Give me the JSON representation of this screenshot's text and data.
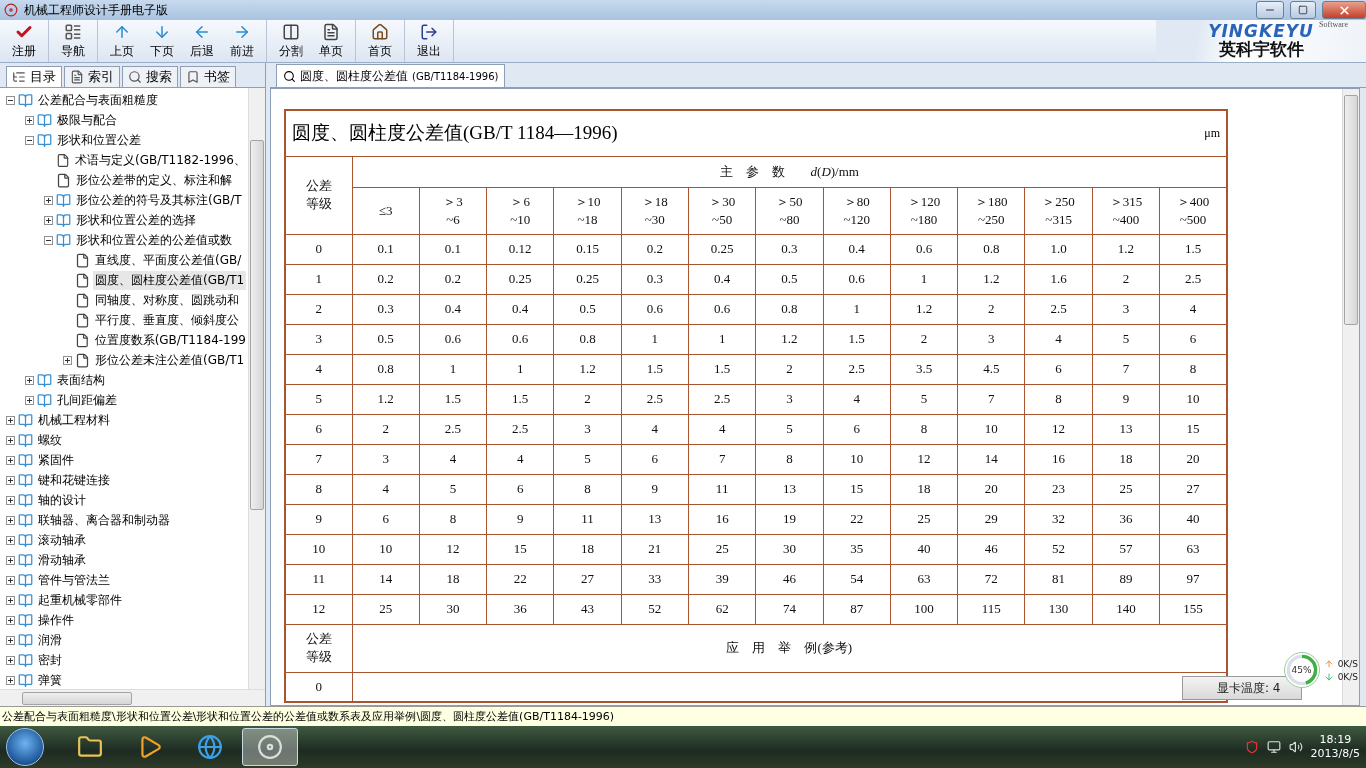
{
  "window": {
    "title": "机械工程师设计手册电子版"
  },
  "toolbar": [
    {
      "buttons": [
        {
          "kind": "register",
          "label": "注册"
        }
      ]
    },
    {
      "buttons": [
        {
          "kind": "nav",
          "label": "导航"
        }
      ]
    },
    {
      "buttons": [
        {
          "kind": "up",
          "label": "上页"
        },
        {
          "kind": "down",
          "label": "下页"
        },
        {
          "kind": "back",
          "label": "后退"
        },
        {
          "kind": "forward",
          "label": "前进"
        }
      ]
    },
    {
      "buttons": [
        {
          "kind": "split",
          "label": "分割"
        },
        {
          "kind": "single",
          "label": "单页"
        }
      ]
    },
    {
      "buttons": [
        {
          "kind": "home",
          "label": "首页"
        }
      ]
    },
    {
      "buttons": [
        {
          "kind": "exit",
          "label": "退出"
        }
      ]
    }
  ],
  "logo": {
    "brand": "YINGKEYU",
    "tag": "Software",
    "name": "英科宇软件"
  },
  "side_tabs": [
    {
      "kind": "toc",
      "label": "目录",
      "selected": true
    },
    {
      "kind": "index",
      "label": "索引",
      "selected": false
    },
    {
      "kind": "search",
      "label": "搜索",
      "selected": false
    },
    {
      "kind": "bookmark",
      "label": "书签",
      "selected": false
    }
  ],
  "tree": [
    {
      "kind": "book",
      "label": "公差配合与表面粗糙度",
      "expanded": true,
      "selected": false,
      "children": [
        {
          "kind": "book",
          "label": "极限与配合",
          "expanded": false,
          "selected": false
        },
        {
          "kind": "book",
          "label": "形状和位置公差",
          "expanded": true,
          "selected": false,
          "children": [
            {
              "kind": "page",
              "label": "术语与定义(GB/T1182-1996、",
              "selected": false
            },
            {
              "kind": "page",
              "label": "形位公差带的定义、标注和解",
              "selected": false
            },
            {
              "kind": "book",
              "label": "形位公差的符号及其标注(GB/T",
              "expanded": false,
              "selected": false
            },
            {
              "kind": "book",
              "label": "形状和位置公差的选择",
              "expanded": false,
              "selected": false
            },
            {
              "kind": "book",
              "label": "形状和位置公差的公差值或数",
              "expanded": true,
              "selected": false,
              "children": [
                {
                  "kind": "page",
                  "label": "直线度、平面度公差值(GB/",
                  "selected": false
                },
                {
                  "kind": "page",
                  "label": "圆度、圆柱度公差值(GB/T1",
                  "selected": true
                },
                {
                  "kind": "page",
                  "label": "同轴度、对称度、圆跳动和",
                  "selected": false
                },
                {
                  "kind": "page",
                  "label": "平行度、垂直度、倾斜度公",
                  "selected": false
                },
                {
                  "kind": "page",
                  "label": "位置度数系(GB/T1184-199",
                  "selected": false
                },
                {
                  "kind": "page",
                  "label": "形位公差未注公差值(GB/T1",
                  "expanded": false,
                  "selected": false
                }
              ]
            }
          ]
        },
        {
          "kind": "book",
          "label": "表面结构",
          "expanded": false,
          "selected": false
        },
        {
          "kind": "book",
          "label": "孔间距偏差",
          "expanded": false,
          "selected": false
        }
      ]
    },
    {
      "kind": "book",
      "label": "机械工程材料",
      "expanded": false,
      "selected": false
    },
    {
      "kind": "book",
      "label": "螺纹",
      "expanded": false,
      "selected": false
    },
    {
      "kind": "book",
      "label": "紧固件",
      "expanded": false,
      "selected": false
    },
    {
      "kind": "book",
      "label": "键和花键连接",
      "expanded": false,
      "selected": false
    },
    {
      "kind": "book",
      "label": "轴的设计",
      "expanded": false,
      "selected": false
    },
    {
      "kind": "book",
      "label": "联轴器、离合器和制动器",
      "expanded": false,
      "selected": false
    },
    {
      "kind": "book",
      "label": "滚动轴承",
      "expanded": false,
      "selected": false
    },
    {
      "kind": "book",
      "label": "滑动轴承",
      "expanded": false,
      "selected": false
    },
    {
      "kind": "book",
      "label": "管件与管法兰",
      "expanded": false,
      "selected": false
    },
    {
      "kind": "book",
      "label": "起重机械零部件",
      "expanded": false,
      "selected": false
    },
    {
      "kind": "book",
      "label": "操作件",
      "expanded": false,
      "selected": false
    },
    {
      "kind": "book",
      "label": "润滑",
      "expanded": false,
      "selected": false
    },
    {
      "kind": "book",
      "label": "密封",
      "expanded": false,
      "selected": false
    },
    {
      "kind": "book",
      "label": "弹簧",
      "expanded": false,
      "selected": false
    }
  ],
  "doc_tab": {
    "title": "圆度、圆柱度公差值",
    "code": "(GB/T1184-1996)"
  },
  "table": {
    "title": "圆度、圆柱度公差值(GB/T 1184—1996)",
    "unit": "μm",
    "grade_header": "公差等级",
    "param_header": "主　参　数　　*d*(*D*)/mm",
    "size_ranges": [
      [
        "≤3"
      ],
      [
        "＞3",
        "~6"
      ],
      [
        "＞6",
        "~10"
      ],
      [
        "＞10",
        "~18"
      ],
      [
        "＞18",
        "~30"
      ],
      [
        "＞30",
        "~50"
      ],
      [
        "＞50",
        "~80"
      ],
      [
        "＞80",
        "~120"
      ],
      [
        "＞120",
        "~180"
      ],
      [
        "＞180",
        "~250"
      ],
      [
        "＞250",
        "~315"
      ],
      [
        "＞315",
        "~400"
      ],
      [
        "＞400",
        "~500"
      ]
    ],
    "rows": [
      [
        "0",
        "0.1",
        "0.1",
        "0.12",
        "0.15",
        "0.2",
        "0.25",
        "0.3",
        "0.4",
        "0.6",
        "0.8",
        "1.0",
        "1.2",
        "1.5"
      ],
      [
        "1",
        "0.2",
        "0.2",
        "0.25",
        "0.25",
        "0.3",
        "0.4",
        "0.5",
        "0.6",
        "1",
        "1.2",
        "1.6",
        "2",
        "2.5"
      ],
      [
        "2",
        "0.3",
        "0.4",
        "0.4",
        "0.5",
        "0.6",
        "0.6",
        "0.8",
        "1",
        "1.2",
        "2",
        "2.5",
        "3",
        "4"
      ],
      [
        "3",
        "0.5",
        "0.6",
        "0.6",
        "0.8",
        "1",
        "1",
        "1.2",
        "1.5",
        "2",
        "3",
        "4",
        "5",
        "6"
      ],
      [
        "4",
        "0.8",
        "1",
        "1",
        "1.2",
        "1.5",
        "1.5",
        "2",
        "2.5",
        "3.5",
        "4.5",
        "6",
        "7",
        "8"
      ],
      [
        "5",
        "1.2",
        "1.5",
        "1.5",
        "2",
        "2.5",
        "2.5",
        "3",
        "4",
        "5",
        "7",
        "8",
        "9",
        "10"
      ],
      [
        "6",
        "2",
        "2.5",
        "2.5",
        "3",
        "4",
        "4",
        "5",
        "6",
        "8",
        "10",
        "12",
        "13",
        "15"
      ],
      [
        "7",
        "3",
        "4",
        "4",
        "5",
        "6",
        "7",
        "8",
        "10",
        "12",
        "14",
        "16",
        "18",
        "20"
      ],
      [
        "8",
        "4",
        "5",
        "6",
        "8",
        "9",
        "11",
        "13",
        "15",
        "18",
        "20",
        "23",
        "25",
        "27"
      ],
      [
        "9",
        "6",
        "8",
        "9",
        "11",
        "13",
        "16",
        "19",
        "22",
        "25",
        "29",
        "32",
        "36",
        "40"
      ],
      [
        "10",
        "10",
        "12",
        "15",
        "18",
        "21",
        "25",
        "30",
        "35",
        "40",
        "46",
        "52",
        "57",
        "63"
      ],
      [
        "11",
        "14",
        "18",
        "22",
        "27",
        "33",
        "39",
        "46",
        "54",
        "63",
        "72",
        "81",
        "89",
        "97"
      ],
      [
        "12",
        "25",
        "30",
        "36",
        "43",
        "52",
        "62",
        "74",
        "87",
        "100",
        "115",
        "130",
        "140",
        "155"
      ]
    ],
    "application_header": {
      "grade_label": "公差等级",
      "text": "应　用　举　例(参考)"
    },
    "application_rows": [
      {
        "grade": "0"
      }
    ]
  },
  "status_bar": "公差配合与表面粗糙度\\形状和位置公差\\形状和位置公差的公差值或数系表及应用举例\\圆度、圆柱度公差值(GB/T1184-1996)",
  "widget": {
    "percent": "45%",
    "level": 0.45,
    "upload": "0K/S",
    "download": "0K/S",
    "gpu_temp": "显卡温度: 4"
  },
  "taskbar": {
    "apps": [
      {
        "kind": "folder",
        "active": false
      },
      {
        "kind": "video",
        "active": false
      },
      {
        "kind": "browser",
        "active": false
      },
      {
        "kind": "manual",
        "active": true
      }
    ],
    "time": "18:19",
    "date": "2013/8/5"
  }
}
